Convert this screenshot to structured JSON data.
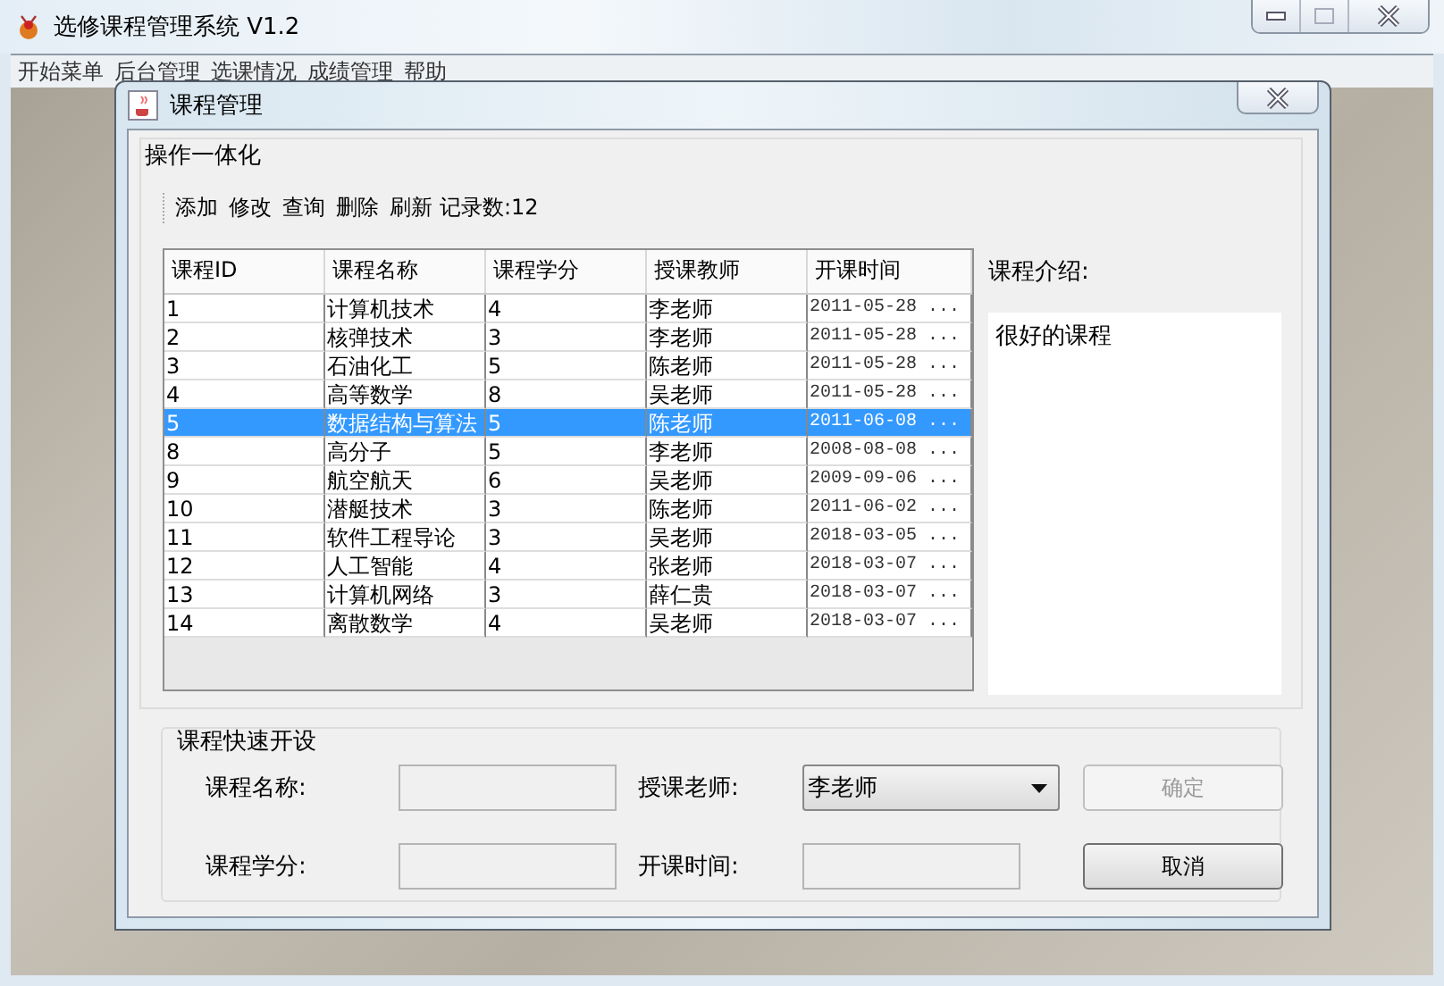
{
  "window": {
    "title": "选修课程管理系统 V1.2"
  },
  "menu": [
    "开始菜单",
    "后台管理",
    "选课情况",
    "成绩管理",
    "帮助"
  ],
  "dialog": {
    "title": "课程管理",
    "group_title": "操作一体化",
    "toolbar": [
      "添加",
      "修改",
      "查询",
      "删除",
      "刷新"
    ],
    "record_count": "记录数:12",
    "table": {
      "columns": [
        "课程ID",
        "课程名称",
        "课程学分",
        "授课教师",
        "开课时间"
      ],
      "rows": [
        {
          "cells": [
            "1",
            "计算机技术",
            "4",
            "李老师",
            "2011-05-28 ..."
          ],
          "selected": false
        },
        {
          "cells": [
            "2",
            "核弹技术",
            "3",
            "李老师",
            "2011-05-28 ..."
          ],
          "selected": false
        },
        {
          "cells": [
            "3",
            "石油化工",
            "5",
            "陈老师",
            "2011-05-28 ..."
          ],
          "selected": false
        },
        {
          "cells": [
            "4",
            "高等数学",
            "8",
            "吴老师",
            "2011-05-28 ..."
          ],
          "selected": false
        },
        {
          "cells": [
            "5",
            "数据结构与算法",
            "5",
            "陈老师",
            "2011-06-08 ..."
          ],
          "selected": true
        },
        {
          "cells": [
            "8",
            "高分子",
            "5",
            "李老师",
            "2008-08-08 ..."
          ],
          "selected": false
        },
        {
          "cells": [
            "9",
            "航空航天",
            "6",
            "吴老师",
            "2009-09-06 ..."
          ],
          "selected": false
        },
        {
          "cells": [
            "10",
            "潜艇技术",
            "3",
            "陈老师",
            "2011-06-02 ..."
          ],
          "selected": false
        },
        {
          "cells": [
            "11",
            "软件工程导论",
            "3",
            "吴老师",
            "2018-03-05 ..."
          ],
          "selected": false
        },
        {
          "cells": [
            "12",
            "人工智能",
            "4",
            "张老师",
            "2018-03-07 ..."
          ],
          "selected": false
        },
        {
          "cells": [
            "13",
            "计算机网络",
            "3",
            "薛仁贵",
            "2018-03-07 ..."
          ],
          "selected": false
        },
        {
          "cells": [
            "14",
            "离散数学",
            "4",
            "吴老师",
            "2018-03-07 ..."
          ],
          "selected": false
        }
      ]
    },
    "intro": {
      "label": "课程介绍:",
      "text": "很好的课程"
    },
    "quick": {
      "title": "课程快速开设",
      "fields": [
        {
          "label": "课程名称:",
          "kind": "text"
        },
        {
          "label": "授课老师:",
          "kind": "select",
          "value": "李老师"
        },
        {
          "label": "课程学分:",
          "kind": "text"
        },
        {
          "label": "开课时间:",
          "kind": "text"
        }
      ],
      "buttons": [
        {
          "label": "确定",
          "disabled": true
        },
        {
          "label": "取消",
          "disabled": false
        }
      ]
    }
  }
}
